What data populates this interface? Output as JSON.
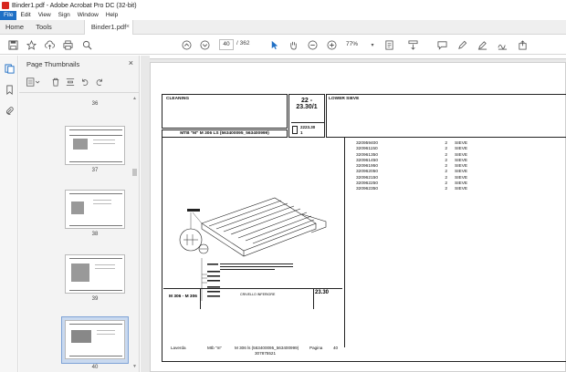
{
  "window": {
    "title": "Binder1.pdf - Adobe Acrobat Pro DC (32-bit)"
  },
  "menu": {
    "items": [
      "File",
      "Edit",
      "View",
      "Sign",
      "Window",
      "Help"
    ]
  },
  "tabs": {
    "home": "Home",
    "tools": "Tools",
    "document": "Binder1.pdf",
    "close": "×"
  },
  "toolbar": {
    "page_current": "40",
    "page_total": "/ 362",
    "zoom": "77%"
  },
  "panel": {
    "title": "Page Thumbnails",
    "close": "×",
    "thumbnails": [
      {
        "label": "36"
      },
      {
        "label": "37"
      },
      {
        "label": "38"
      },
      {
        "label": "39"
      },
      {
        "label": "40"
      }
    ]
  },
  "document": {
    "header": {
      "section": "CLEANING",
      "code_line1": "22 -",
      "code_line2": "23.30/1",
      "title": "LOWER SIEVE",
      "model": "MTB \"M\" M 306 LS (563400095_563400999)",
      "ref": "2223.30",
      "ref_sub": "1"
    },
    "parts": [
      {
        "code": "320959400",
        "qty": "2",
        "desc": "SIEVE"
      },
      {
        "code": "320961150",
        "qty": "2",
        "desc": "SIEVE"
      },
      {
        "code": "320961350",
        "qty": "2",
        "desc": "SIEVE"
      },
      {
        "code": "320961450",
        "qty": "2",
        "desc": "SIEVE"
      },
      {
        "code": "320961950",
        "qty": "2",
        "desc": "SIEVE"
      },
      {
        "code": "320962050",
        "qty": "2",
        "desc": "SIEVE"
      },
      {
        "code": "320962150",
        "qty": "2",
        "desc": "SIEVE"
      },
      {
        "code": "320962250",
        "qty": "2",
        "desc": "SIEVE"
      },
      {
        "code": "320962350",
        "qty": "2",
        "desc": "SIEVE"
      }
    ],
    "drawing": {
      "model": "M 306 - M 306",
      "page_code": "23.30",
      "caption": "CRIVELLO INFERIORE"
    },
    "footer": {
      "brand": "Laverda",
      "mtb": "Mtb \"m\"",
      "model": "M 306 ls (563400095_563400999)",
      "code": "307875521",
      "page_label": "Pagina",
      "page_no": "40"
    }
  }
}
